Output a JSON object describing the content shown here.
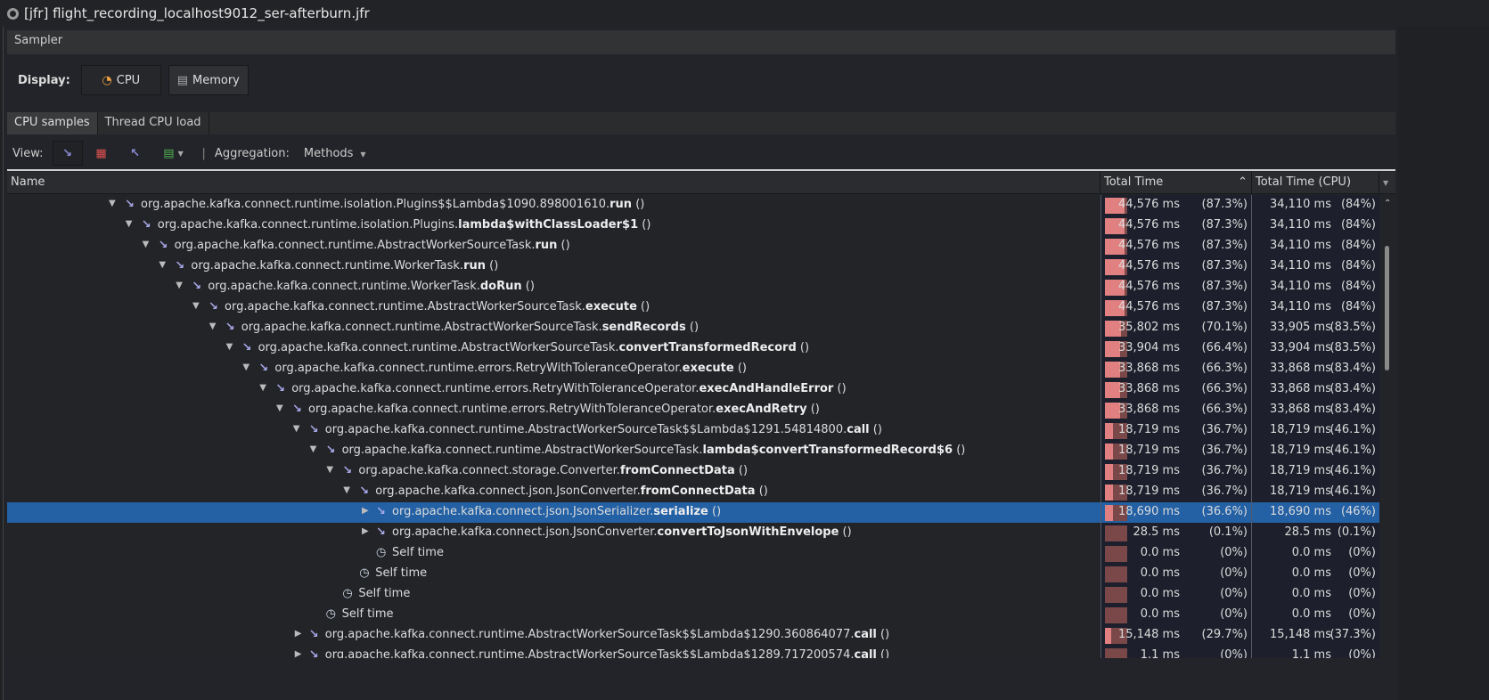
{
  "window": {
    "title": "[jfr] flight_recording_localhost9012_ser-afterburn.jfr"
  },
  "sampler": {
    "title": "Sampler"
  },
  "display": {
    "label": "Display:",
    "cpu": "CPU",
    "memory": "Memory"
  },
  "tabs": [
    "CPU samples",
    "Thread CPU load"
  ],
  "viewbar": {
    "view_label": "View:",
    "aggregation_label": "Aggregation:",
    "aggregation_value": "Methods"
  },
  "columns": {
    "name": "Name",
    "total": "Total Time",
    "cpu": "Total Time (CPU)"
  },
  "rows": [
    {
      "lvl": 0,
      "tog": "down",
      "icon": "arrow",
      "pre": "org.apache.kafka.connect.runtime.isolation.Plugins$$Lambda$1090.898001610.",
      "m": "run",
      "suf": " ()",
      "t": "44,576 ms",
      "tp": "(87.3%)",
      "tpv": 87.3,
      "c": "34,110 ms",
      "cp": "(84%)"
    },
    {
      "lvl": 1,
      "tog": "down",
      "icon": "arrow",
      "pre": "org.apache.kafka.connect.runtime.isolation.Plugins.",
      "m": "lambda$withClassLoader$1",
      "suf": " ()",
      "t": "44,576 ms",
      "tp": "(87.3%)",
      "tpv": 87.3,
      "c": "34,110 ms",
      "cp": "(84%)"
    },
    {
      "lvl": 2,
      "tog": "down",
      "icon": "arrow",
      "pre": "org.apache.kafka.connect.runtime.AbstractWorkerSourceTask.",
      "m": "run",
      "suf": " ()",
      "t": "44,576 ms",
      "tp": "(87.3%)",
      "tpv": 87.3,
      "c": "34,110 ms",
      "cp": "(84%)"
    },
    {
      "lvl": 3,
      "tog": "down",
      "icon": "arrow",
      "pre": "org.apache.kafka.connect.runtime.WorkerTask.",
      "m": "run",
      "suf": " ()",
      "t": "44,576 ms",
      "tp": "(87.3%)",
      "tpv": 87.3,
      "c": "34,110 ms",
      "cp": "(84%)"
    },
    {
      "lvl": 4,
      "tog": "down",
      "icon": "arrow",
      "pre": "org.apache.kafka.connect.runtime.WorkerTask.",
      "m": "doRun",
      "suf": " ()",
      "t": "44,576 ms",
      "tp": "(87.3%)",
      "tpv": 87.3,
      "c": "34,110 ms",
      "cp": "(84%)"
    },
    {
      "lvl": 5,
      "tog": "down",
      "icon": "arrow",
      "pre": "org.apache.kafka.connect.runtime.AbstractWorkerSourceTask.",
      "m": "execute",
      "suf": " ()",
      "t": "44,576 ms",
      "tp": "(87.3%)",
      "tpv": 87.3,
      "c": "34,110 ms",
      "cp": "(84%)"
    },
    {
      "lvl": 6,
      "tog": "down",
      "icon": "arrow",
      "pre": "org.apache.kafka.connect.runtime.AbstractWorkerSourceTask.",
      "m": "sendRecords",
      "suf": " ()",
      "t": "35,802 ms",
      "tp": "(70.1%)",
      "tpv": 70.1,
      "c": "33,905 ms",
      "cp": "(83.5%)"
    },
    {
      "lvl": 7,
      "tog": "down",
      "icon": "arrow",
      "pre": "org.apache.kafka.connect.runtime.AbstractWorkerSourceTask.",
      "m": "convertTransformedRecord",
      "suf": " ()",
      "t": "33,904 ms",
      "tp": "(66.4%)",
      "tpv": 66.4,
      "c": "33,904 ms",
      "cp": "(83.5%)"
    },
    {
      "lvl": 8,
      "tog": "down",
      "icon": "arrow",
      "pre": "org.apache.kafka.connect.runtime.errors.RetryWithToleranceOperator.",
      "m": "execute",
      "suf": " ()",
      "t": "33,868 ms",
      "tp": "(66.3%)",
      "tpv": 66.3,
      "c": "33,868 ms",
      "cp": "(83.4%)"
    },
    {
      "lvl": 9,
      "tog": "down",
      "icon": "arrow",
      "pre": "org.apache.kafka.connect.runtime.errors.RetryWithToleranceOperator.",
      "m": "execAndHandleError",
      "suf": " ()",
      "t": "33,868 ms",
      "tp": "(66.3%)",
      "tpv": 66.3,
      "c": "33,868 ms",
      "cp": "(83.4%)"
    },
    {
      "lvl": 10,
      "tog": "down",
      "icon": "arrow",
      "pre": "org.apache.kafka.connect.runtime.errors.RetryWithToleranceOperator.",
      "m": "execAndRetry",
      "suf": " ()",
      "t": "33,868 ms",
      "tp": "(66.3%)",
      "tpv": 66.3,
      "c": "33,868 ms",
      "cp": "(83.4%)"
    },
    {
      "lvl": 11,
      "tog": "down",
      "icon": "arrow",
      "pre": "org.apache.kafka.connect.runtime.AbstractWorkerSourceTask$$Lambda$1291.54814800.",
      "m": "call",
      "suf": " ()",
      "t": "18,719 ms",
      "tp": "(36.7%)",
      "tpv": 36.7,
      "c": "18,719 ms",
      "cp": "(46.1%)"
    },
    {
      "lvl": 12,
      "tog": "down",
      "icon": "arrow",
      "pre": "org.apache.kafka.connect.runtime.AbstractWorkerSourceTask.",
      "m": "lambda$convertTransformedRecord$6",
      "suf": " ()",
      "t": "18,719 ms",
      "tp": "(36.7%)",
      "tpv": 36.7,
      "c": "18,719 ms",
      "cp": "(46.1%)"
    },
    {
      "lvl": 13,
      "tog": "down",
      "icon": "arrow",
      "pre": "org.apache.kafka.connect.storage.Converter.",
      "m": "fromConnectData",
      "suf": " ()",
      "t": "18,719 ms",
      "tp": "(36.7%)",
      "tpv": 36.7,
      "c": "18,719 ms",
      "cp": "(46.1%)"
    },
    {
      "lvl": 14,
      "tog": "down",
      "icon": "arrow",
      "pre": "org.apache.kafka.connect.json.JsonConverter.",
      "m": "fromConnectData",
      "suf": " ()",
      "t": "18,719 ms",
      "tp": "(36.7%)",
      "tpv": 36.7,
      "c": "18,719 ms",
      "cp": "(46.1%)"
    },
    {
      "lvl": 15,
      "tog": "right",
      "icon": "arrow",
      "sel": true,
      "pre": "org.apache.kafka.connect.json.JsonSerializer.",
      "m": "serialize",
      "suf": " ()",
      "t": "18,690 ms",
      "tp": "(36.6%)",
      "tpv": 36.6,
      "c": "18,690 ms",
      "cp": "(46%)"
    },
    {
      "lvl": 15,
      "tog": "right",
      "icon": "arrow",
      "pre": "org.apache.kafka.connect.json.JsonConverter.",
      "m": "convertToJsonWithEnvelope",
      "suf": " ()",
      "t": "28.5 ms",
      "tp": "(0.1%)",
      "tpv": 0.1,
      "c": "28.5 ms",
      "cp": "(0.1%)"
    },
    {
      "lvl": 15,
      "tog": "none",
      "icon": "clock",
      "pre": "Self time",
      "m": "",
      "suf": "",
      "t": "0.0 ms",
      "tp": "(0%)",
      "tpv": 0,
      "c": "0.0 ms",
      "cp": "(0%)"
    },
    {
      "lvl": 14,
      "tog": "none",
      "icon": "clock",
      "pre": "Self time",
      "m": "",
      "suf": "",
      "t": "0.0 ms",
      "tp": "(0%)",
      "tpv": 0,
      "c": "0.0 ms",
      "cp": "(0%)"
    },
    {
      "lvl": 13,
      "tog": "none",
      "icon": "clock",
      "pre": "Self time",
      "m": "",
      "suf": "",
      "t": "0.0 ms",
      "tp": "(0%)",
      "tpv": 0,
      "c": "0.0 ms",
      "cp": "(0%)"
    },
    {
      "lvl": 12,
      "tog": "none",
      "icon": "clock",
      "pre": "Self time",
      "m": "",
      "suf": "",
      "t": "0.0 ms",
      "tp": "(0%)",
      "tpv": 0,
      "c": "0.0 ms",
      "cp": "(0%)"
    },
    {
      "lvl": 11,
      "tog": "right",
      "icon": "arrow",
      "pre": "org.apache.kafka.connect.runtime.AbstractWorkerSourceTask$$Lambda$1290.360864077.",
      "m": "call",
      "suf": " ()",
      "t": "15,148 ms",
      "tp": "(29.7%)",
      "tpv": 29.7,
      "c": "15,148 ms",
      "cp": "(37.3%)"
    },
    {
      "lvl": 11,
      "tog": "right",
      "icon": "arrow",
      "pre": "org.apache.kafka.connect.runtime.AbstractWorkerSourceTask$$Lambda$1289.717200574.",
      "m": "call",
      "suf": " ()",
      "t": "1.1 ms",
      "tp": "(0%)",
      "tpv": 0,
      "c": "1.1 ms",
      "cp": "(0%)"
    }
  ]
}
